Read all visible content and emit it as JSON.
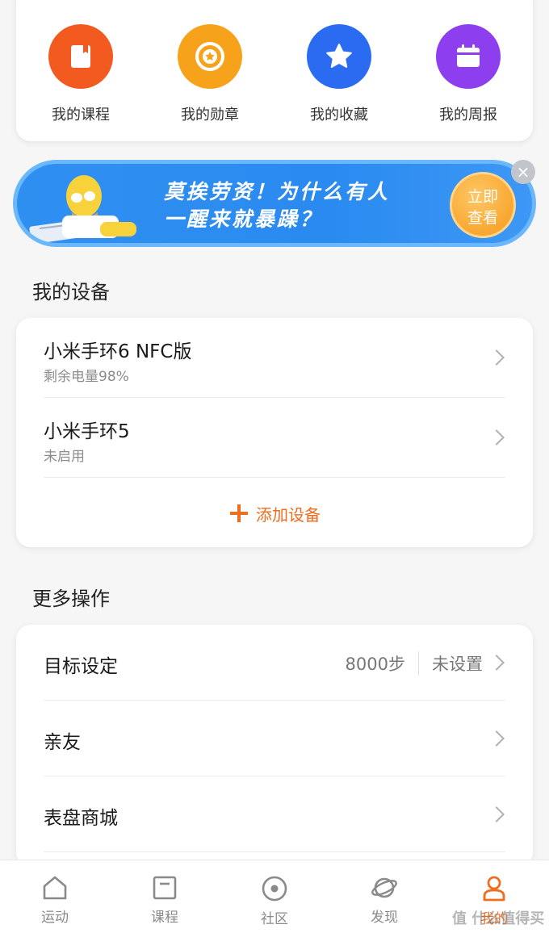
{
  "shortcuts": [
    {
      "label": "我的课程",
      "icon": "book-icon",
      "color": "#f25a1f"
    },
    {
      "label": "我的勋章",
      "icon": "medal-icon",
      "color": "#f6a31b"
    },
    {
      "label": "我的收藏",
      "icon": "star-icon",
      "color": "#2a6bf2"
    },
    {
      "label": "我的周报",
      "icon": "calendar-icon",
      "color": "#8d3ff0"
    }
  ],
  "banner": {
    "line1": "莫挨劳资！为什么有人",
    "line2": "一醒来就暴躁？",
    "button_line1": "立即",
    "button_line2": "查看",
    "close": "×"
  },
  "devices_section": {
    "title": "我的设备",
    "items": [
      {
        "name": "小米手环6 NFC版",
        "status": "剩余电量98%"
      },
      {
        "name": "小米手环5",
        "status": "未启用"
      }
    ],
    "add_label": "添加设备"
  },
  "more_section": {
    "title": "更多操作",
    "items": [
      {
        "label": "目标设定",
        "value": "8000步",
        "status": "未设置"
      },
      {
        "label": "亲友"
      },
      {
        "label": "表盘商城"
      }
    ]
  },
  "bottom_nav": [
    {
      "label": "运动",
      "icon": "house-icon"
    },
    {
      "label": "课程",
      "icon": "course-icon"
    },
    {
      "label": "社区",
      "icon": "community-icon"
    },
    {
      "label": "发现",
      "icon": "discover-icon"
    },
    {
      "label": "我的",
      "icon": "person-icon",
      "active": true
    }
  ],
  "watermark": "值 什么值得买",
  "colors": {
    "accent": "#f06d1e",
    "banner_blue": "#2a8af0"
  }
}
